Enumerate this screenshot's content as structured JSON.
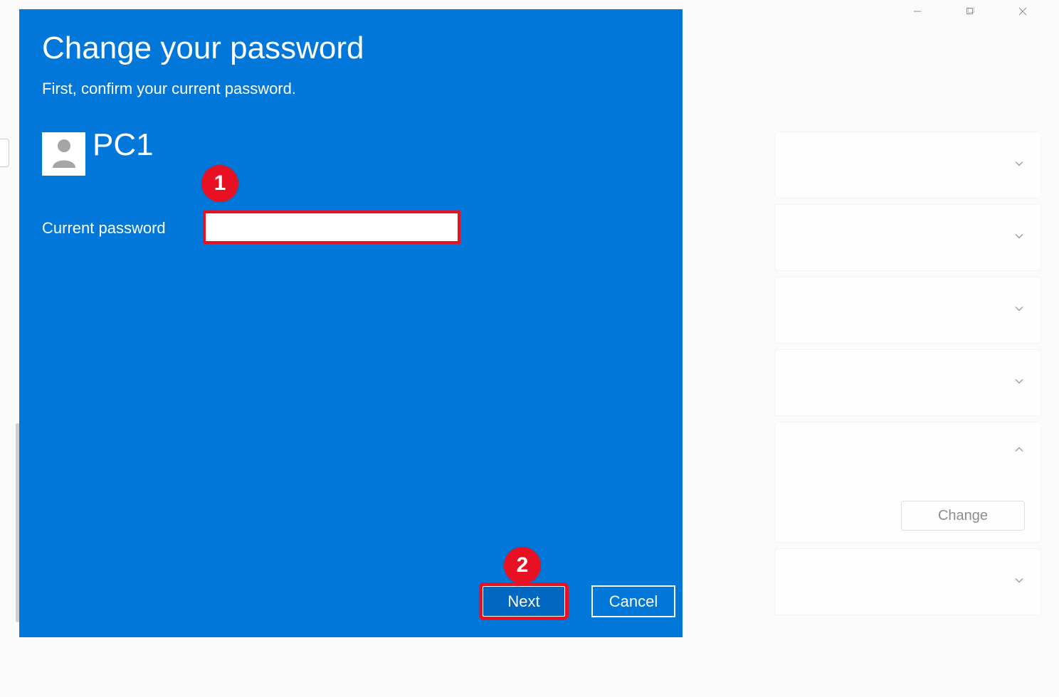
{
  "window_controls": {
    "minimize": "minimize",
    "maximize": "maximize",
    "close": "close"
  },
  "background": {
    "change_button_label": "Change"
  },
  "dialog": {
    "title": "Change your password",
    "subtitle": "First, confirm your current password.",
    "username": "PC1",
    "field_label": "Current password",
    "current_password_value": "",
    "next_label": "Next",
    "cancel_label": "Cancel"
  },
  "annotations": {
    "badge1": "1",
    "badge2": "2"
  }
}
